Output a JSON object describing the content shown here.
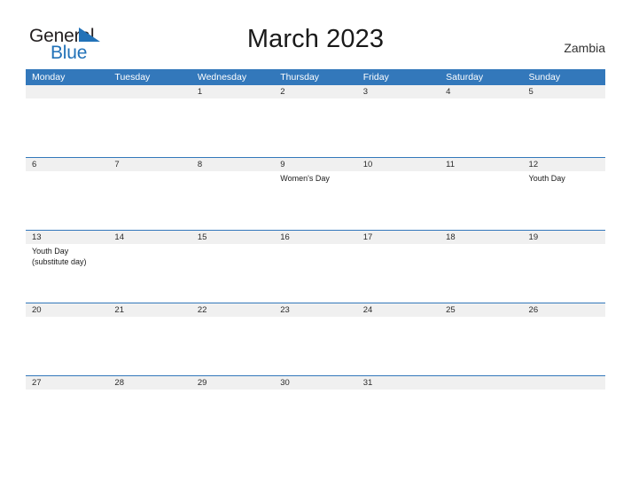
{
  "brand": {
    "name_part1": "General",
    "name_part2": "Blue",
    "flag_icon": "triangle-flag-icon",
    "accent_color": "#2272b8"
  },
  "header": {
    "title": "March 2023",
    "country": "Zambia"
  },
  "colors": {
    "weekday_header_bg": "#3378bb",
    "daynum_band_bg": "#f0f0f0",
    "rule": "#3378bb",
    "text": "#1a1a1a"
  },
  "calendar": {
    "month": "March",
    "year": "2023",
    "weekdays": [
      "Monday",
      "Tuesday",
      "Wednesday",
      "Thursday",
      "Friday",
      "Saturday",
      "Sunday"
    ],
    "weeks": [
      {
        "days": [
          {
            "num": "",
            "events": []
          },
          {
            "num": "",
            "events": []
          },
          {
            "num": "1",
            "events": []
          },
          {
            "num": "2",
            "events": []
          },
          {
            "num": "3",
            "events": []
          },
          {
            "num": "4",
            "events": []
          },
          {
            "num": "5",
            "events": []
          }
        ]
      },
      {
        "days": [
          {
            "num": "6",
            "events": []
          },
          {
            "num": "7",
            "events": []
          },
          {
            "num": "8",
            "events": []
          },
          {
            "num": "9",
            "events": [
              "Women's Day"
            ]
          },
          {
            "num": "10",
            "events": []
          },
          {
            "num": "11",
            "events": []
          },
          {
            "num": "12",
            "events": [
              "Youth Day"
            ]
          }
        ]
      },
      {
        "days": [
          {
            "num": "13",
            "events": [
              "Youth Day",
              "(substitute day)"
            ]
          },
          {
            "num": "14",
            "events": []
          },
          {
            "num": "15",
            "events": []
          },
          {
            "num": "16",
            "events": []
          },
          {
            "num": "17",
            "events": []
          },
          {
            "num": "18",
            "events": []
          },
          {
            "num": "19",
            "events": []
          }
        ]
      },
      {
        "days": [
          {
            "num": "20",
            "events": []
          },
          {
            "num": "21",
            "events": []
          },
          {
            "num": "22",
            "events": []
          },
          {
            "num": "23",
            "events": []
          },
          {
            "num": "24",
            "events": []
          },
          {
            "num": "25",
            "events": []
          },
          {
            "num": "26",
            "events": []
          }
        ]
      },
      {
        "days": [
          {
            "num": "27",
            "events": []
          },
          {
            "num": "28",
            "events": []
          },
          {
            "num": "29",
            "events": []
          },
          {
            "num": "30",
            "events": []
          },
          {
            "num": "31",
            "events": []
          },
          {
            "num": "",
            "events": []
          },
          {
            "num": "",
            "events": []
          }
        ]
      }
    ]
  }
}
